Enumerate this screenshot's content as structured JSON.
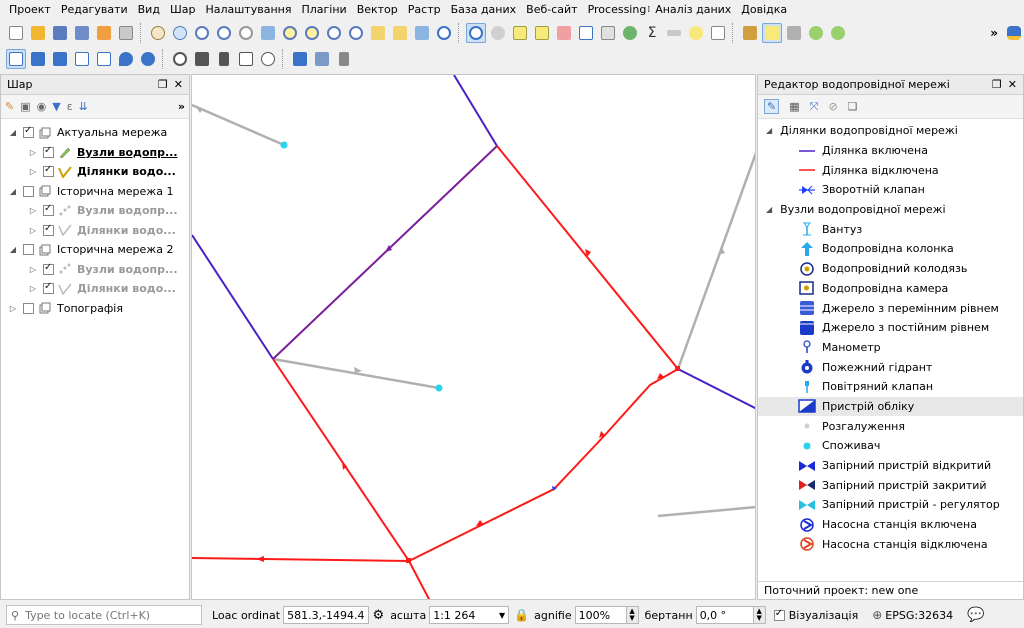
{
  "menu": [
    "Проект",
    "Редагувати",
    "Вид",
    "Шар",
    "Налаштування",
    "Плагіни",
    "Вектор",
    "Растр",
    "База даних",
    "Веб-сайт",
    "Processing",
    "Аналіз даних",
    "Довідка"
  ],
  "layers_panel": {
    "title": "Шар",
    "more": "»",
    "layers": [
      {
        "label": "Актуальна мережа",
        "expanded": true,
        "checked": true,
        "level": 0,
        "style": "normal"
      },
      {
        "label": "Вузли водопр...",
        "expanded": false,
        "checked": true,
        "level": 1,
        "style": "bold-underline"
      },
      {
        "label": "Ділянки водо...",
        "expanded": false,
        "checked": true,
        "level": 1,
        "style": "bold"
      },
      {
        "label": "Історична мережа 1",
        "expanded": true,
        "checked": false,
        "level": 0,
        "style": "normal"
      },
      {
        "label": "Вузли водопр...",
        "expanded": false,
        "checked": true,
        "level": 1,
        "style": "dim"
      },
      {
        "label": "Ділянки водо...",
        "expanded": false,
        "checked": true,
        "level": 1,
        "style": "dim"
      },
      {
        "label": "Історична мережа 2",
        "expanded": true,
        "checked": false,
        "level": 0,
        "style": "normal"
      },
      {
        "label": "Вузли водопр...",
        "expanded": false,
        "checked": true,
        "level": 1,
        "style": "dim"
      },
      {
        "label": "Ділянки водо...",
        "expanded": false,
        "checked": true,
        "level": 1,
        "style": "dim"
      },
      {
        "label": "Топографія",
        "expanded": false,
        "checked": false,
        "level": 0,
        "style": "normal"
      }
    ]
  },
  "network_panel": {
    "title": "Редактор водопровідної мережі",
    "groups": [
      {
        "label": "Ділянки водопровідної мережі",
        "items": [
          {
            "label": "Ділянка включена",
            "symbol": "line-blue-icon"
          },
          {
            "label": "Ділянка відключена",
            "symbol": "line-red-icon"
          },
          {
            "label": "Зворотній клапан",
            "symbol": "check-valve-icon"
          }
        ]
      },
      {
        "label": "Вузли водопровідної мережі",
        "items": [
          {
            "label": "Вантуз",
            "symbol": "air-valve-icon"
          },
          {
            "label": "Водопровідна колонка",
            "symbol": "water-column-icon"
          },
          {
            "label": "Водопровідний колодязь",
            "symbol": "water-well-icon"
          },
          {
            "label": "Водопровідна камера",
            "symbol": "water-chamber-icon"
          },
          {
            "label": "Джерело з перемінним рівнем",
            "symbol": "variable-source-icon"
          },
          {
            "label": "Джерело з постійним рівнем",
            "symbol": "constant-source-icon"
          },
          {
            "label": "Манометр",
            "symbol": "manometer-icon"
          },
          {
            "label": "Пожежний гідрант",
            "symbol": "hydrant-icon"
          },
          {
            "label": "Повітряний клапан",
            "symbol": "air-valve-small-icon"
          },
          {
            "label": "Пристрій обліку",
            "symbol": "meter-icon"
          },
          {
            "label": "Розгалуження",
            "symbol": "junction-icon"
          },
          {
            "label": "Споживач",
            "symbol": "consumer-icon"
          },
          {
            "label": "Запірний пристрій відкритий",
            "symbol": "valve-open-icon"
          },
          {
            "label": "Запірний пристрій закритий",
            "symbol": "valve-closed-icon"
          },
          {
            "label": "Запірний пристрій - регулятор",
            "symbol": "valve-regulator-icon"
          },
          {
            "label": "Насосна станція включена",
            "symbol": "pump-on-icon"
          },
          {
            "label": "Насосна станція відключена",
            "symbol": "pump-off-icon"
          }
        ]
      }
    ],
    "selected": "Пристрій обліку",
    "current_project": "Поточний проект: new one"
  },
  "statusbar": {
    "locate_placeholder": "Type to locate (Ctrl+K)",
    "coord_label": "Loac ordinat",
    "coord_value": "581.3,-1494.4",
    "scale_label": "асшта",
    "scale_value": "1:1 264",
    "magnifier_label": "agnifie",
    "magnifier_value": "100%",
    "rotation_label": "бертанн",
    "rotation_value": "0,0 °",
    "render_label": "Візуалізація",
    "crs": "EPSG:32634"
  },
  "colors": {
    "pipe_enabled": "#4b1fc4",
    "pipe_disabled": "#ff1a1a",
    "pipe_purple": "#7a1f9a",
    "pipe_historic": "#b0b0b0",
    "consumer": "#29d3f0"
  }
}
